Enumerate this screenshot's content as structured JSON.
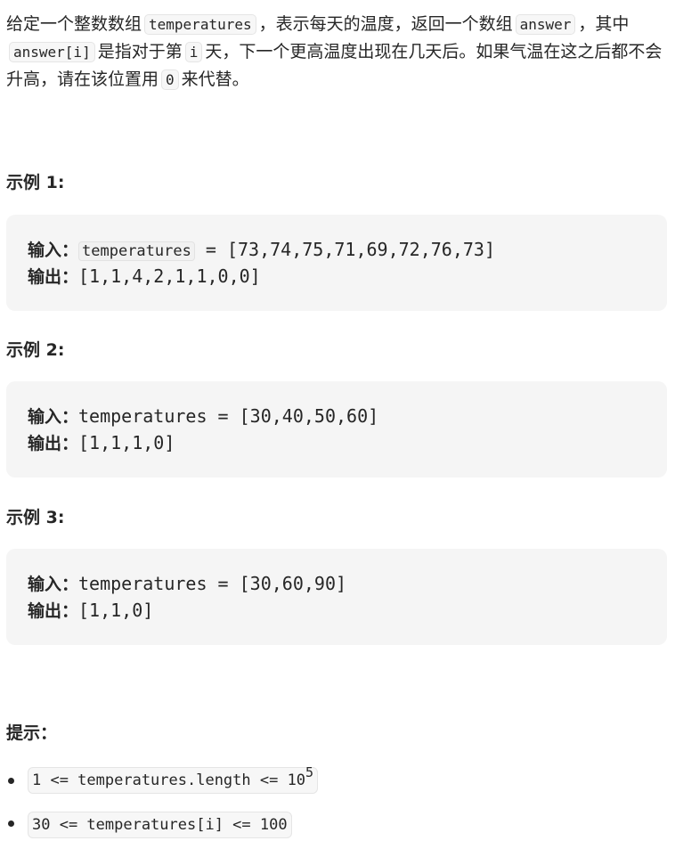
{
  "description": {
    "p1": "给定一个整数数组",
    "c1": "temperatures",
    "p2": "，表示每天的温度，返回一个数组",
    "c2": "answer",
    "p3": "，其中",
    "c3": "answer[i]",
    "p4": "是指对于第",
    "c4": "i",
    "p5": "天，下一个更高温度出现在几天后。如果气温在这之后都不会升高，请在该位置用",
    "c5": "0",
    "p6": "来代替。"
  },
  "examples": [
    {
      "title": "示例 1:",
      "input_label": "输入：",
      "input_var": "temperatures",
      "input_rest": " = [73,74,75,71,69,72,76,73]",
      "output_label": "输出：",
      "output_value": "[1,1,4,2,1,1,0,0]"
    },
    {
      "title": "示例 2:",
      "input_label": "输入：",
      "input_value": "temperatures = [30,40,50,60]",
      "output_label": "输出：",
      "output_value": "[1,1,1,0]"
    },
    {
      "title": "示例 3:",
      "input_label": "输入：",
      "input_value": "temperatures = [30,60,90]",
      "output_label": "输出：",
      "output_value": "[1,1,0]"
    }
  ],
  "hints": {
    "title": "提示：",
    "items": [
      {
        "text": "1 <= temperatures.length <= 10",
        "sup": "5"
      },
      {
        "text": "30 <= temperatures[i] <= 100"
      }
    ]
  }
}
